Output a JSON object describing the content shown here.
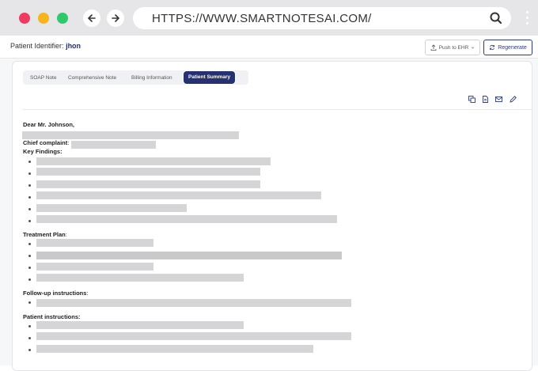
{
  "browser": {
    "url": "HTTPS://WWW.SMARTNOTESAI.COM/",
    "traffic_colors": [
      "#ef3b61",
      "#f6b51a",
      "#2fc96c"
    ]
  },
  "header": {
    "patient_label": "Patient Identifier:",
    "patient_name": "jhon",
    "push_label": "Push to EHR",
    "regenerate_label": "Regenerate"
  },
  "tabs": [
    {
      "label": "SOAP Note",
      "active": false
    },
    {
      "label": "Comprehensive Note",
      "active": false
    },
    {
      "label": "Billing Information",
      "active": false
    },
    {
      "label": "Patient Summary",
      "active": true
    }
  ],
  "toolbar_icons": [
    "copy-icon",
    "document-icon",
    "mail-icon",
    "edit-icon"
  ],
  "summary": {
    "greeting": "Dear Mr. Johnson,",
    "chief_complaint_label": "Chief complaint",
    "colon": ":",
    "key_findings_label": "Key Findings:",
    "treatment_plan_label": "Treatment Plan",
    "followup_label": "Follow-up instructions",
    "patient_instructions_label": "Patient instructions:"
  }
}
